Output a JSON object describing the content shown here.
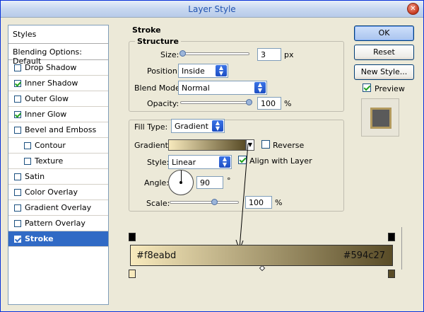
{
  "window": {
    "title": "Layer Style"
  },
  "styles_panel": {
    "header": "Styles",
    "blending_options": "Blending Options: Default",
    "items": [
      {
        "label": "Drop Shadow",
        "checked": false,
        "sub": false,
        "selected": false
      },
      {
        "label": "Inner Shadow",
        "checked": true,
        "sub": false,
        "selected": false
      },
      {
        "label": "Outer Glow",
        "checked": false,
        "sub": false,
        "selected": false
      },
      {
        "label": "Inner Glow",
        "checked": true,
        "sub": false,
        "selected": false
      },
      {
        "label": "Bevel and Emboss",
        "checked": false,
        "sub": false,
        "selected": false
      },
      {
        "label": "Contour",
        "checked": false,
        "sub": true,
        "selected": false
      },
      {
        "label": "Texture",
        "checked": false,
        "sub": true,
        "selected": false
      },
      {
        "label": "Satin",
        "checked": false,
        "sub": false,
        "selected": false
      },
      {
        "label": "Color Overlay",
        "checked": false,
        "sub": false,
        "selected": false
      },
      {
        "label": "Gradient Overlay",
        "checked": false,
        "sub": false,
        "selected": false
      },
      {
        "label": "Pattern Overlay",
        "checked": false,
        "sub": false,
        "selected": false
      },
      {
        "label": "Stroke",
        "checked": true,
        "sub": false,
        "selected": true
      }
    ]
  },
  "stroke": {
    "section_title": "Stroke",
    "structure": {
      "title": "Structure",
      "size_label": "Size:",
      "size_value": "3",
      "size_unit": "px",
      "position_label": "Position:",
      "position_value": "Inside",
      "blend_mode_label": "Blend Mode:",
      "blend_mode_value": "Normal",
      "opacity_label": "Opacity:",
      "opacity_value": "100",
      "opacity_unit": "%"
    },
    "fill": {
      "fill_type_label": "Fill Type:",
      "fill_type_value": "Gradient",
      "gradient_label": "Gradient:",
      "reverse_label": "Reverse",
      "reverse_checked": false,
      "style_label": "Style:",
      "style_value": "Linear",
      "align_label": "Align with Layer",
      "align_checked": true,
      "angle_label": "Angle:",
      "angle_value": "90",
      "angle_unit": "°",
      "scale_label": "Scale:",
      "scale_value": "100",
      "scale_unit": "%"
    }
  },
  "buttons": {
    "ok": "OK",
    "reset": "Reset",
    "new_style": "New Style...",
    "preview_label": "Preview",
    "preview_checked": true
  },
  "gradient_editor": {
    "start_color": "#f8eabd",
    "end_color": "#594c27",
    "start_label": "#f8eabd",
    "end_label": "#594c27"
  }
}
